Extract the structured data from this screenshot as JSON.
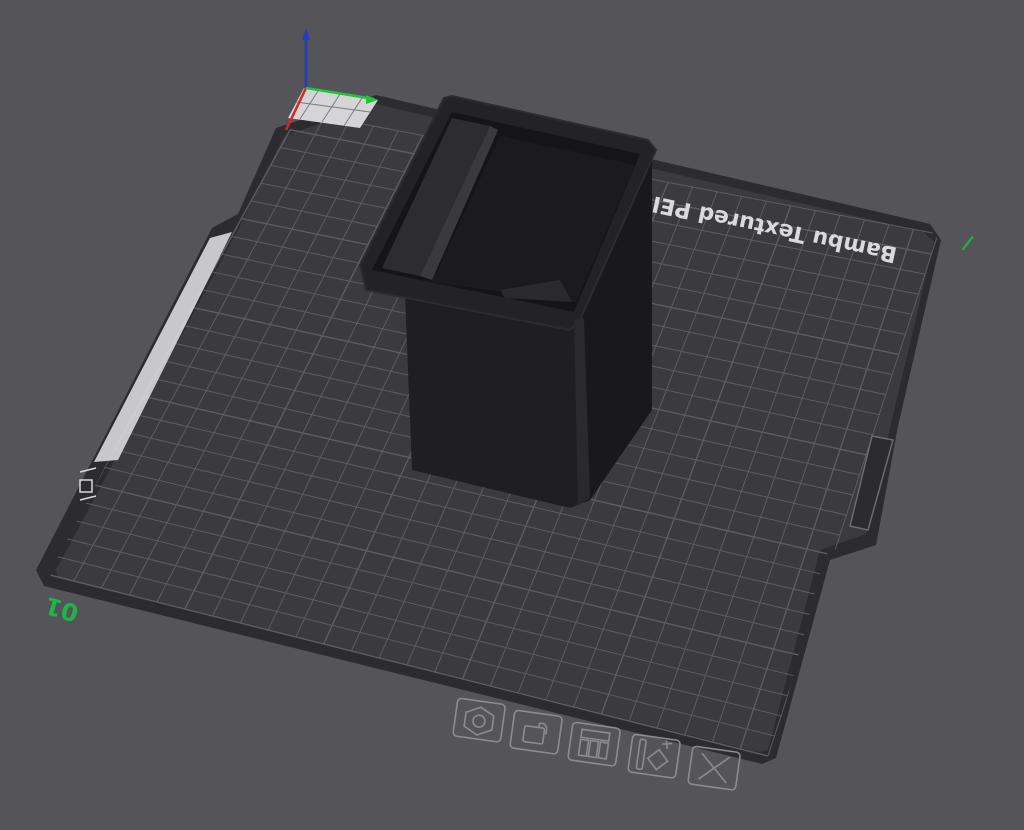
{
  "plate": {
    "label": "Bambu Textured PEI Plate",
    "plate_number": "01",
    "colors": {
      "background": "#545459",
      "plate_edge": "#2c2c30",
      "plate_surface": "#3a3a3f",
      "grid": "#5c5c63",
      "label_text": "#d9d9de",
      "number_text": "#22b24c"
    }
  },
  "axes": {
    "x_color": "#d8262b",
    "y_color": "#22c23a",
    "z_color": "#1f3fbf"
  },
  "model": {
    "name": "bin",
    "color": "#1f1f22"
  },
  "plate_toolbar": {
    "buttons": [
      {
        "name": "orient-button",
        "icon": "hexagon-nut-icon"
      },
      {
        "name": "lock-button",
        "icon": "lock-icon"
      },
      {
        "name": "arrange-button",
        "icon": "arrange-icon"
      },
      {
        "name": "plate-settings-button",
        "icon": "plate-settings-icon"
      },
      {
        "name": "delete-plate-button",
        "icon": "close-icon"
      }
    ]
  }
}
